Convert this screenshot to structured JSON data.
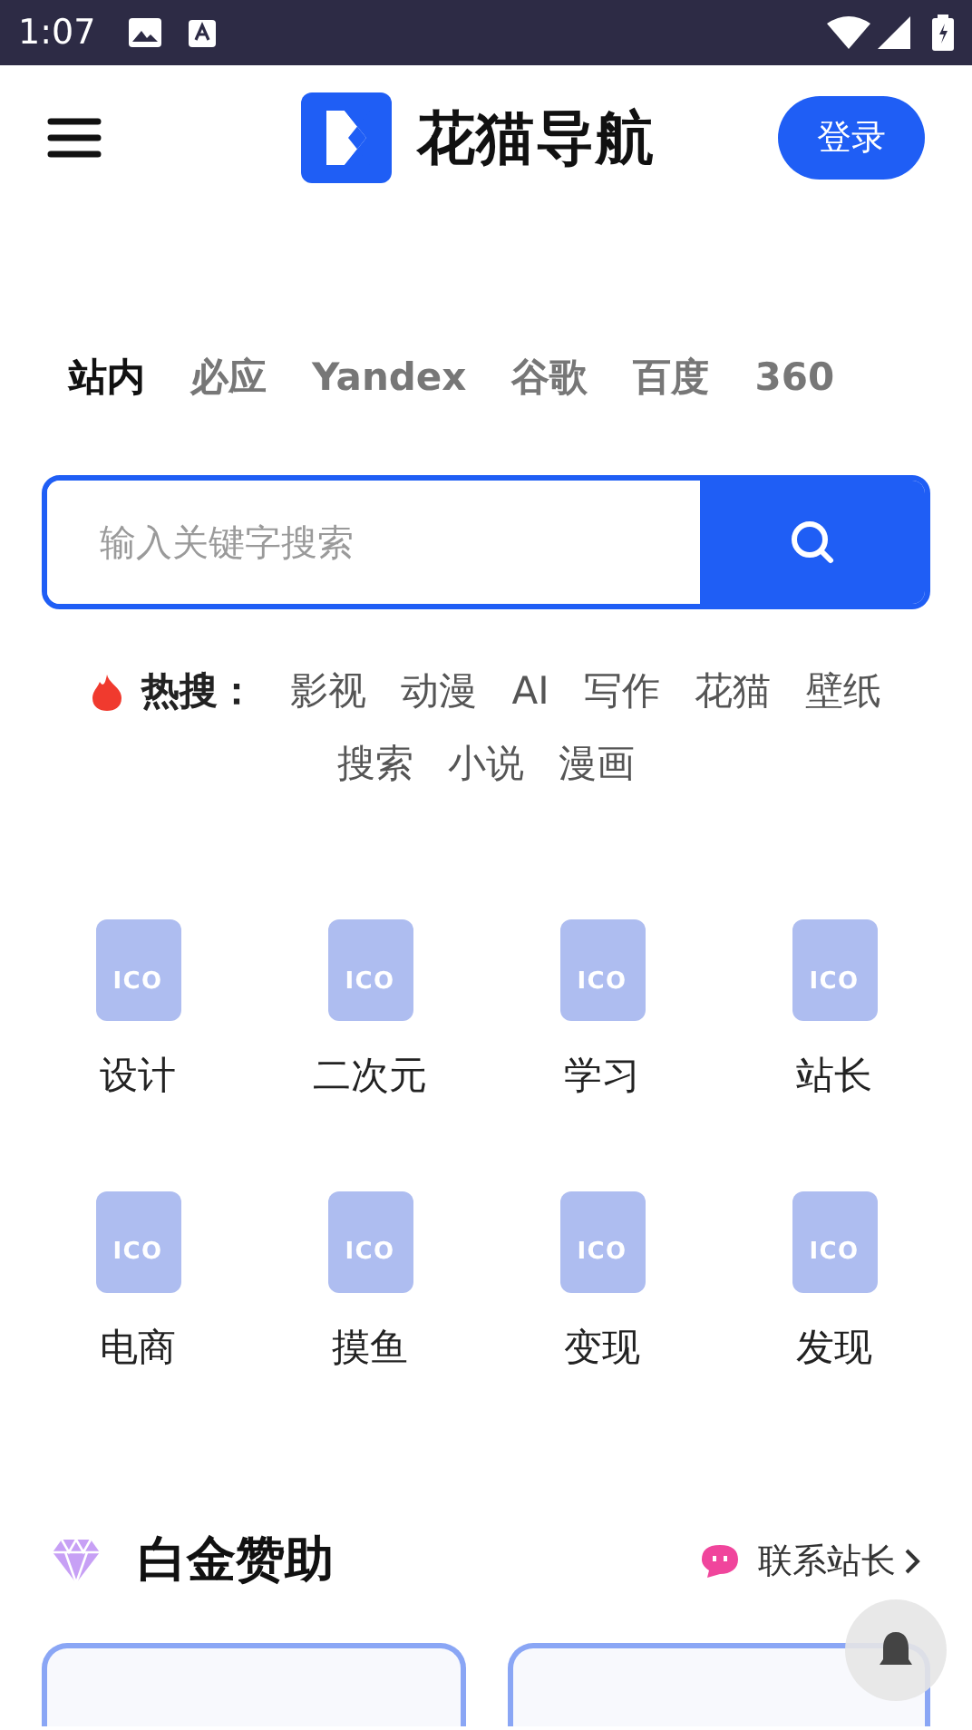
{
  "status_bar": {
    "time": "1:07"
  },
  "header": {
    "brand": "花猫导航",
    "login_button": "登录"
  },
  "search_tabs": [
    {
      "label": "站内",
      "selected": true
    },
    {
      "label": "必应",
      "selected": false
    },
    {
      "label": "Yandex",
      "selected": false
    },
    {
      "label": "谷歌",
      "selected": false
    },
    {
      "label": "百度",
      "selected": false
    },
    {
      "label": "360",
      "selected": false
    }
  ],
  "search": {
    "placeholder": "输入关键字搜索"
  },
  "hot": {
    "label": "热搜：",
    "terms": [
      "影视",
      "动漫",
      "AI",
      "写作",
      "花猫",
      "壁纸",
      "搜索",
      "小说",
      "漫画"
    ]
  },
  "categories": [
    {
      "icon_text": "ICO",
      "label": "设计"
    },
    {
      "icon_text": "ICO",
      "label": "二次元"
    },
    {
      "icon_text": "ICO",
      "label": "学习"
    },
    {
      "icon_text": "ICO",
      "label": "站长"
    },
    {
      "icon_text": "ICO",
      "label": "电商"
    },
    {
      "icon_text": "ICO",
      "label": "摸鱼"
    },
    {
      "icon_text": "ICO",
      "label": "变现"
    },
    {
      "icon_text": "ICO",
      "label": "发现"
    }
  ],
  "sponsor": {
    "title": "白金赞助",
    "contact": "联系站长"
  }
}
